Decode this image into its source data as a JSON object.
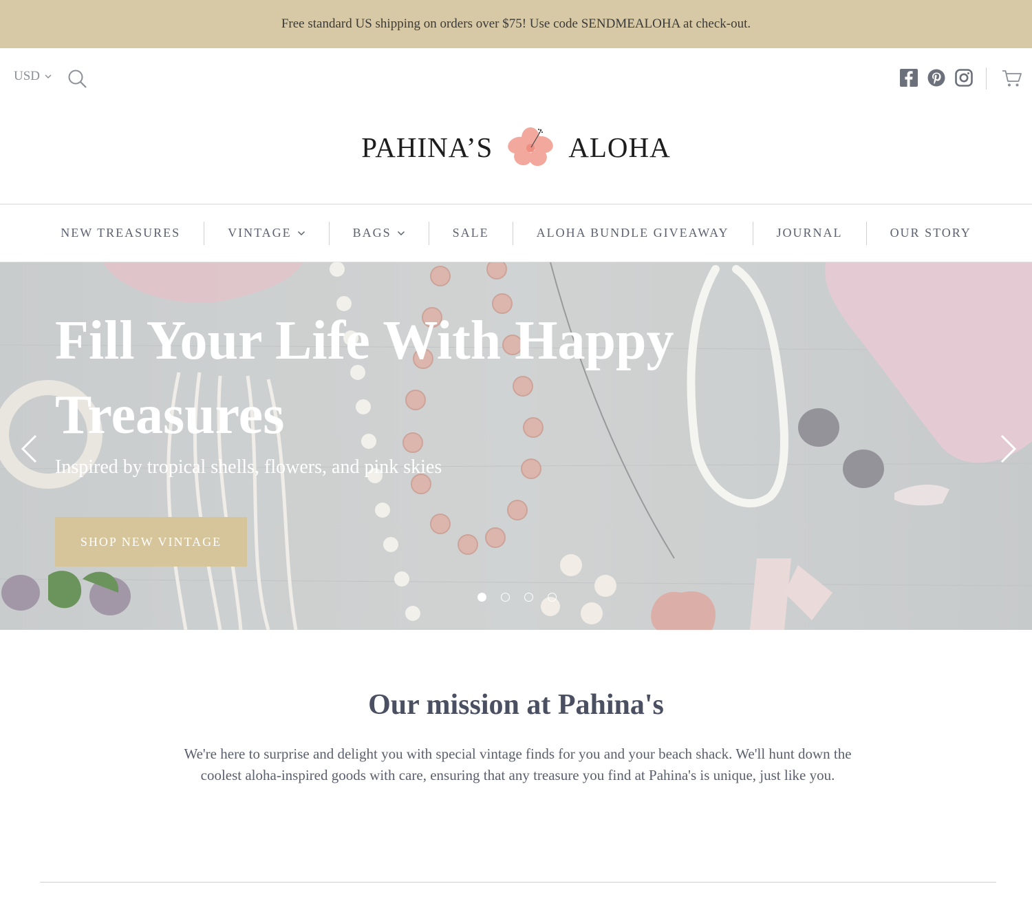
{
  "announcement": "Free standard US shipping on orders over $75! Use code SENDMEALOHA at check-out.",
  "utility": {
    "currency": "USD",
    "social_icons": [
      "facebook-icon",
      "pinterest-icon",
      "instagram-icon"
    ],
    "cart_icon": "cart-icon",
    "search_icon": "search-icon"
  },
  "logo": {
    "left_word": "PAHINA’S",
    "right_word": "ALOHA",
    "flower_color": "#f2a89c"
  },
  "nav": {
    "items": [
      {
        "label": "NEW TREASURES"
      },
      {
        "label": "VINTAGE"
      },
      {
        "label": "BAGS"
      },
      {
        "label": "SALE"
      },
      {
        "label": "ALOHA BUNDLE GIVEAWAY"
      },
      {
        "label": "JOURNAL"
      },
      {
        "label": "OUR STORY"
      }
    ]
  },
  "hero": {
    "title": "Fill Your Life With Happy Treasures",
    "subtitle": "Inspired by tropical shells, flowers, and pink skies",
    "cta": "SHOP NEW VINTAGE",
    "slides_total": 4,
    "active_slide": 1
  },
  "mission": {
    "title": "Our mission at Pahina's",
    "body": "We're here to surprise and delight you with special vintage finds for you and your beach shack. We'll hunt down the coolest aloha-inspired goods with care, ensuring that any treasure you find at Pahina's is unique, just like you."
  },
  "colors": {
    "announcement_bg": "#d8c9a6",
    "cta_bg": "#d6c49b",
    "text": "#4a4f5c"
  }
}
